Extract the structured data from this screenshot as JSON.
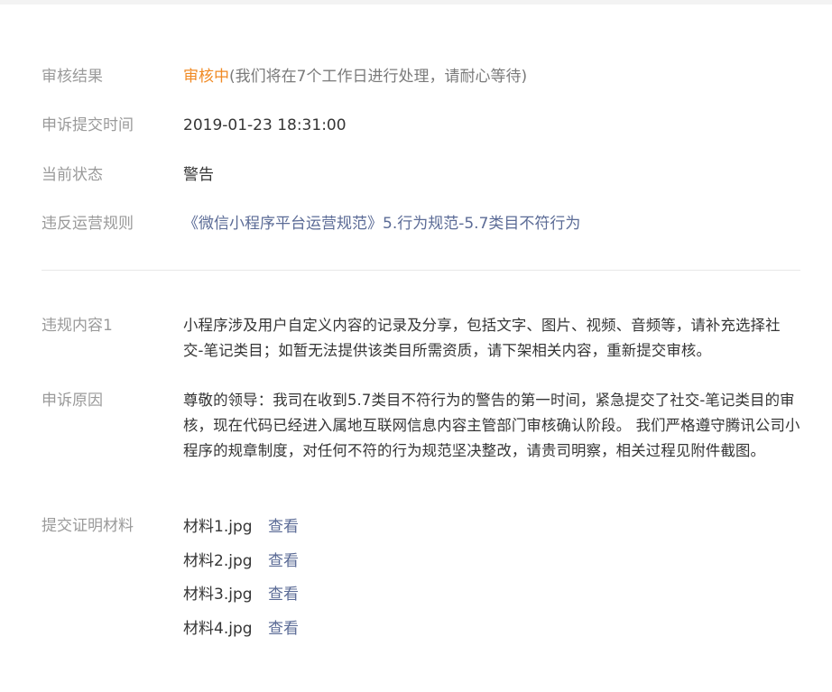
{
  "review": {
    "result_label": "审核结果",
    "result_status": "审核中",
    "result_note": "(我们将在7个工作日进行处理，请耐心等待)",
    "submit_time_label": "申诉提交时间",
    "submit_time": "2019-01-23 18:31:00",
    "current_state_label": "当前状态",
    "current_state": "警告",
    "violated_rule_label": "违反运营规则",
    "violated_rule": "《微信小程序平台运营规范》5.行为规范-5.7类目不符行为"
  },
  "details": {
    "violation_label": "违规内容1",
    "violation_text": "小程序涉及用户自定义内容的记录及分享，包括文字、图片、视频、音频等，请补充选择社交-笔记类目；如暂无法提供该类目所需资质，请下架相关内容，重新提交审核。",
    "reason_label": "申诉原因",
    "reason_text": "尊敬的领导：我司在收到5.7类目不符行为的警告的第一时间，紧急提交了社交-笔记类目的审核，现在代码已经进入属地互联网信息内容主管部门审核确认阶段。 我们严格遵守腾讯公司小程序的规章制度，对任何不符的行为规范坚决整改，请贵司明察，相关过程见附件截图。",
    "materials_label": "提交证明材料",
    "view_label": "查看",
    "materials": [
      "材料1.jpg",
      "材料2.jpg",
      "材料3.jpg",
      "材料4.jpg"
    ]
  },
  "colors": {
    "status_accent": "#f08a24",
    "link": "#5b6b96",
    "label": "#9a9a9a"
  }
}
